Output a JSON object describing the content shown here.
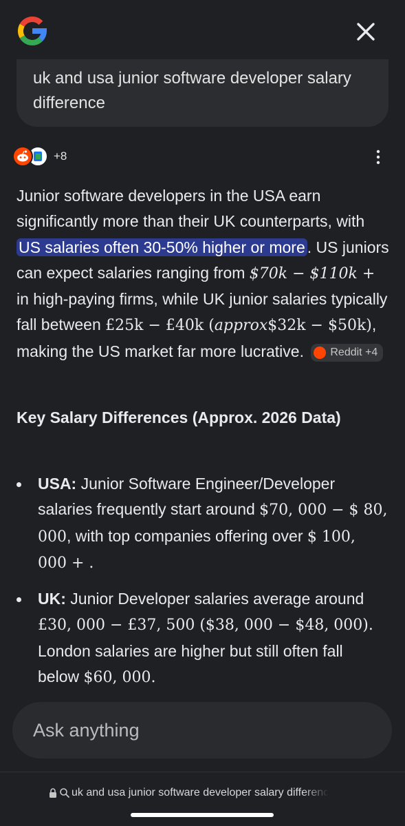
{
  "header": {
    "logo_icon": "google-g-logo-icon",
    "close_icon": "close-icon"
  },
  "query": {
    "text": "uk and usa junior software developer salary difference"
  },
  "sources": {
    "more_label": "+8",
    "menu_icon": "more-vert-icon"
  },
  "answer": {
    "p1": "Junior software developers in the USA earn significantly more than their UK counterparts, with ",
    "highlight": "US salaries often 30-50% higher or more",
    "p2": ". US juniors can expect salaries ranging from ",
    "m1": "$70k − $110k +",
    "p3": " in high-paying firms, while UK junior salaries typically fall between ",
    "m2": "£25k − £40k (",
    "m3": "approx",
    "m4": "$32k − $50k)",
    "p4": ", making the US market far more lucrative.",
    "citation_label": "Reddit +4"
  },
  "section": {
    "heading": "Key Salary Differences (Approx. 2026 Data)"
  },
  "bullets": [
    {
      "label": "USA:",
      "t1": " Junior Software Engineer/Developer salaries frequently start around ",
      "m1": "$70, 000 − $ 80, 000",
      "t2": ", with top companies offering over ",
      "m2": "$ 100, 000 + ."
    },
    {
      "label": "UK:",
      "t1": " Junior Developer salaries average around ",
      "m1": "£30, 000 − £37, 500 ($38, 000 − $48, 000).",
      "t2": " London salaries are higher but still often fall below ",
      "m2": "$60, 000."
    }
  ],
  "ask": {
    "placeholder": "Ask anything"
  },
  "url_bar": {
    "text": "uk and usa junior software developer salary differenc"
  },
  "colors": {
    "background": "#1f2023",
    "highlight": "#2c3b8f",
    "reddit": "#ff4500"
  }
}
